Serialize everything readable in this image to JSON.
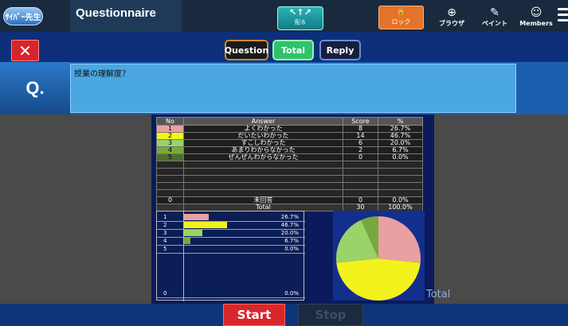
{
  "header": {
    "logo_text": "ｻｲﾊﾞｰ先生",
    "title": "Questionnaire",
    "distribute": {
      "icon": "distribute-icon",
      "label": "配る"
    },
    "lock": {
      "icon": "lock-icon",
      "label": "ロック"
    },
    "browser": {
      "icon": "globe-icon",
      "label": "ブラウザ"
    },
    "paint": {
      "icon": "pen-icon",
      "label": "ペイント"
    },
    "members": {
      "icon": "user-icon",
      "label": "Members"
    }
  },
  "tabs": {
    "question": "Question",
    "total": "Total",
    "reply": "Reply"
  },
  "question": {
    "label": "Q.",
    "text": "授業の理解度？"
  },
  "table": {
    "headers": [
      "No",
      "Answer",
      "Score",
      "%"
    ],
    "rows": [
      {
        "no": "1",
        "answer": "よくわかった",
        "score": "8",
        "pct": "26.7%",
        "color": "#e8a0a0"
      },
      {
        "no": "2",
        "answer": "だいたいわかった",
        "score": "14",
        "pct": "46.7%",
        "color": "#f2f21c"
      },
      {
        "no": "3",
        "answer": "すこしわかった",
        "score": "6",
        "pct": "20.0%",
        "color": "#9ad36a"
      },
      {
        "no": "4",
        "answer": "あまりわからなかった",
        "score": "2",
        "pct": "6.7%",
        "color": "#76a83c"
      },
      {
        "no": "5",
        "answer": "ぜんぜんわからなかった",
        "score": "0",
        "pct": "0.0%",
        "color": "#4e6e2c"
      }
    ],
    "unanswered": {
      "no": "0",
      "answer": "未回答",
      "score": "0",
      "pct": "0.0%"
    },
    "total": {
      "label": "Total",
      "score": "30",
      "pct": "100.0%"
    }
  },
  "chart_data": [
    {
      "type": "bar",
      "categories": [
        "1",
        "2",
        "3",
        "4",
        "5",
        "0"
      ],
      "values": [
        26.7,
        46.7,
        20.0,
        6.7,
        0.0,
        0.0
      ],
      "value_labels": [
        "26.7%",
        "46.7%",
        "20.0%",
        "6.7%",
        "0.0%",
        "0.0%"
      ],
      "colors": [
        "#e8a0a0",
        "#f2f21c",
        "#9ad36a",
        "#76a83c",
        "#4e6e2c",
        "#888888"
      ]
    },
    {
      "type": "pie",
      "categories": [
        "1",
        "2",
        "3",
        "4",
        "5"
      ],
      "values": [
        8,
        14,
        6,
        2,
        0
      ],
      "colors": [
        "#e8a0a0",
        "#f2f21c",
        "#9ad36a",
        "#76a83c",
        "#4e6e2c"
      ],
      "title": "Total"
    }
  ],
  "footer": {
    "start": "Start",
    "stop": "Stop"
  }
}
